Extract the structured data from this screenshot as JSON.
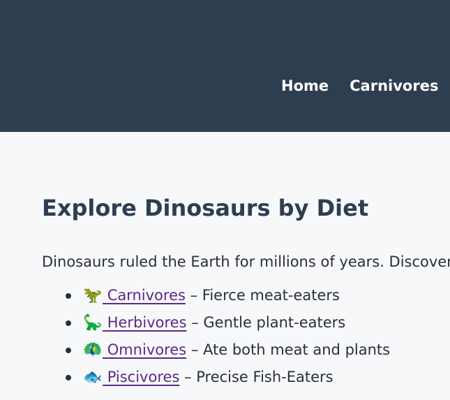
{
  "header": {
    "nav": [
      {
        "label": "Home"
      },
      {
        "label": "Carnivores"
      }
    ]
  },
  "main": {
    "title": "Explore Dinosaurs by Diet",
    "intro": "Dinosaurs ruled the Earth for millions of years. Discover",
    "diets": [
      {
        "icon_glyph": "🦖",
        "icon": "t-rex-icon",
        "label": "Carnivores",
        "description": "– Fierce meat-eaters"
      },
      {
        "icon_glyph": "🦕",
        "icon": "sauropod-icon",
        "label": "Herbivores",
        "description": "– Gentle plant-eaters"
      },
      {
        "icon_glyph": "🦚",
        "icon": "peacock-icon",
        "label": "Omnivores",
        "description": "– Ate both meat and plants"
      },
      {
        "icon_glyph": "🐟",
        "icon": "fish-icon",
        "label": "Piscivores",
        "description": "– Precise Fish-Eaters"
      }
    ]
  },
  "colors": {
    "header_bg": "#2e3e51",
    "page_bg": "#f7f8fa",
    "link": "#5b2a86",
    "title": "#2e3e51"
  }
}
